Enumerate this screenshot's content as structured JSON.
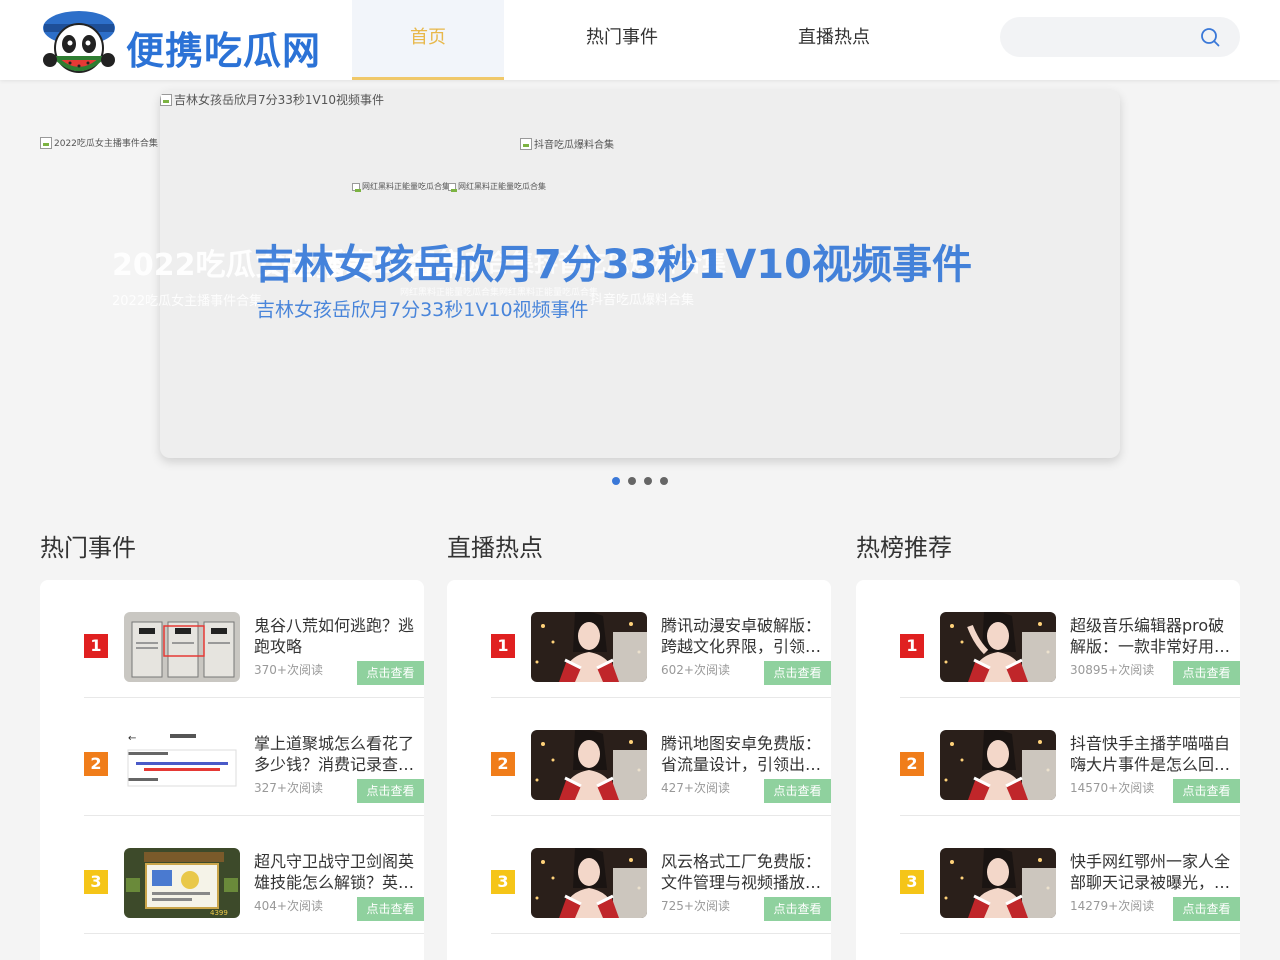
{
  "header": {
    "logo_text": "便携吃瓜网",
    "nav": [
      {
        "label": "首页",
        "active": true
      },
      {
        "label": "热门事件",
        "active": false
      },
      {
        "label": "直播热点",
        "active": false
      }
    ],
    "search": {
      "value": "",
      "placeholder": ""
    }
  },
  "colors": {
    "brand_blue": "#2b72d6",
    "nav_active": "#e8b84a",
    "rank1": "#e02020",
    "rank2": "#f07d1a",
    "rank3": "#f5c518",
    "button_green": "#8fd19e",
    "dot_active": "#3a78d8"
  },
  "banner": {
    "main_alt": "吉林女孩岳欣月7分33秒1V10视频事件",
    "left_alt": "2022吃瓜女主播事件合集",
    "right_alt": "抖音吃瓜爆料合集",
    "center_alt_1": "网红黑料正能量吃瓜合集",
    "center_alt_2": "网红黑料正能量吃瓜合集",
    "left_title": "2022吃瓜女主播事件合集",
    "left_sub": "2022吃瓜女主播事件合集",
    "main_title": "吉林女孩岳欣月7分33秒1V10视频事件",
    "main_sub": "吉林女孩岳欣月7分33秒1V10视频事件",
    "right_sub": "抖音吃瓜爆料合集",
    "overlap_title": "网红黑料正能量吃瓜合集抖音吃瓜爆料合集",
    "overlap_sub": "网红黑料正能量吃瓜合集网红黑料正能量吃瓜合集",
    "dots_count": 4,
    "active_dot": 0
  },
  "columns": [
    {
      "title": "热门事件",
      "items": [
        {
          "rank": "1",
          "title": "鬼谷八荒如何逃跑？逃跑攻略",
          "reads": "370+次阅读",
          "button": "点击查看",
          "thumb": "game-doors"
        },
        {
          "rank": "2",
          "title": "掌上道聚城怎么看花了多少钱？消费记录查看方法",
          "reads": "327+次阅读",
          "button": "点击查看",
          "thumb": "app-record"
        },
        {
          "rank": "3",
          "title": "超凡守卫战守卫剑阁英雄技能怎么解锁？英雄解锁方法",
          "reads": "404+次阅读",
          "button": "点击查看",
          "thumb": "game-ui"
        }
      ]
    },
    {
      "title": "直播热点",
      "items": [
        {
          "rank": "1",
          "title": "腾讯动漫安卓破解版：跨越文化界限，引领动漫潮流",
          "reads": "602+次阅读",
          "button": "点击查看",
          "thumb": "streamer"
        },
        {
          "rank": "2",
          "title": "腾讯地图安卓免费版：省流量设计，引领出行新体验",
          "reads": "427+次阅读",
          "button": "点击查看",
          "thumb": "streamer"
        },
        {
          "rank": "3",
          "title": "风云格式工厂免费版：文件管理与视频播放一体化",
          "reads": "725+次阅读",
          "button": "点击查看",
          "thumb": "streamer"
        }
      ]
    },
    {
      "title": "热榜推荐",
      "items": [
        {
          "rank": "1",
          "title": "超级音乐编辑器pro破解版：一款非常好用的音乐编辑软件",
          "reads": "30895+次阅读",
          "button": "点击查看",
          "thumb": "streamer-pose"
        },
        {
          "rank": "2",
          "title": "抖音快手主播芋喵喵自嗨大片事件是怎么回事？",
          "reads": "14570+次阅读",
          "button": "点击查看",
          "thumb": "streamer"
        },
        {
          "rank": "3",
          "title": "快手网红鄂州一家人全部聊天记录被曝光，事件始末",
          "reads": "14279+次阅读",
          "button": "点击查看",
          "thumb": "streamer"
        }
      ]
    }
  ]
}
